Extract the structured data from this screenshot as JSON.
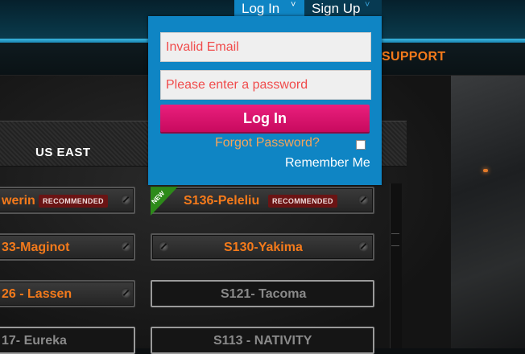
{
  "header": {
    "login_tab": "Log In",
    "signup_tab": "Sign Up",
    "chevron": "˅"
  },
  "nav": {
    "support": "SUPPORT"
  },
  "login_panel": {
    "email_placeholder": "Invalid Email",
    "password_placeholder": "Please enter a password",
    "login_button": "Log In",
    "forgot_password": "Forgot Password?",
    "remember_me": "Remember Me"
  },
  "server_list": {
    "region": "US EAST",
    "badge_text": "RECOMMENDED",
    "new_ribbon": "NEW",
    "servers": [
      {
        "name": "werin",
        "recommended": true,
        "active": true
      },
      {
        "name": "S136-Peleliu",
        "recommended": true,
        "active": true,
        "is_new": true
      },
      {
        "name": "33-Maginot",
        "active": true
      },
      {
        "name": "S130-Yakima",
        "active": true
      },
      {
        "name": "26 - Lassen",
        "active": true
      },
      {
        "name": "S121- Tacoma",
        "active": false
      },
      {
        "name": "17- Eureka",
        "active": false
      },
      {
        "name": "S113 - NATIVITY",
        "active": false
      }
    ]
  },
  "colors": {
    "accent_blue": "#0f85c4",
    "login_button": "#e0177a",
    "server_name_active": "#f47a1b",
    "error_text": "#f04b4b",
    "badge": "#6a1414"
  }
}
